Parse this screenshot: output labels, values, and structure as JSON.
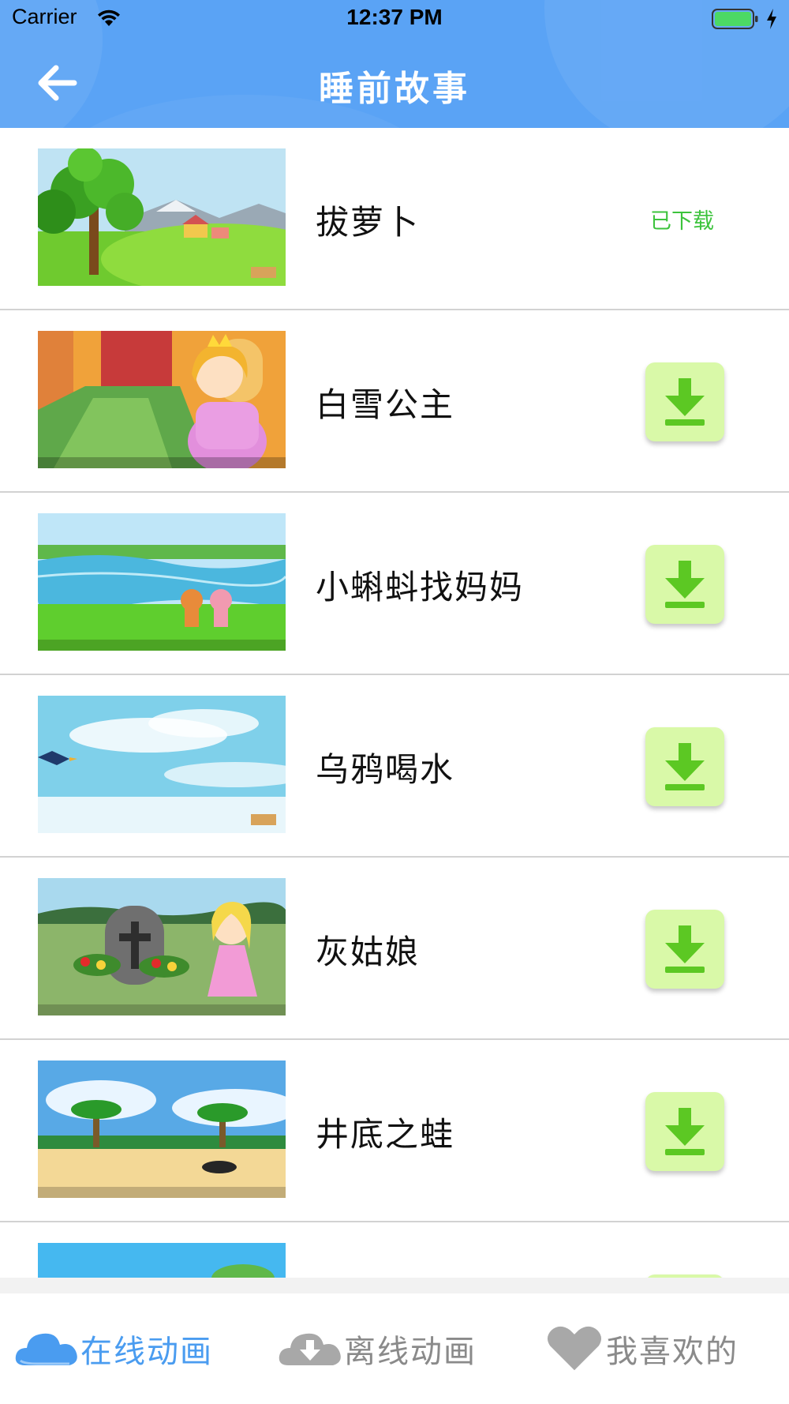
{
  "status_bar": {
    "carrier": "Carrier",
    "time": "12:37 PM",
    "battery_color": "#4cd964"
  },
  "nav": {
    "back_icon": "arrow-left-icon",
    "title": "睡前故事",
    "background_color": "#5aa3f5"
  },
  "stories": [
    {
      "title": "拔萝卜",
      "status": "已下载",
      "downloaded": true,
      "thumbnail": "meadow-tree-scene"
    },
    {
      "title": "白雪公主",
      "downloaded": false,
      "thumbnail": "princess-scene"
    },
    {
      "title": "小蝌蚪找妈妈",
      "downloaded": false,
      "thumbnail": "river-scene"
    },
    {
      "title": "乌鸦喝水",
      "downloaded": false,
      "thumbnail": "sky-crow-scene"
    },
    {
      "title": "灰姑娘",
      "downloaded": false,
      "thumbnail": "tombstone-girl-scene"
    },
    {
      "title": "井底之蛙",
      "downloaded": false,
      "thumbnail": "beach-palm-scene"
    },
    {
      "title": "",
      "downloaded": false,
      "thumbnail": "sky-scene-partial"
    }
  ],
  "colors": {
    "accent": "#4a9cf0",
    "downloaded_text": "#3cc33c",
    "download_button_bg": "#d9f9a8",
    "download_icon": "#5cc823",
    "inactive_tab": "#8a8a8a"
  },
  "tabs": [
    {
      "label": "在线动画",
      "icon": "cloud-icon",
      "active": true
    },
    {
      "label": "离线动画",
      "icon": "cloud-download-icon",
      "active": false
    },
    {
      "label": "我喜欢的",
      "icon": "heart-icon",
      "active": false
    }
  ]
}
